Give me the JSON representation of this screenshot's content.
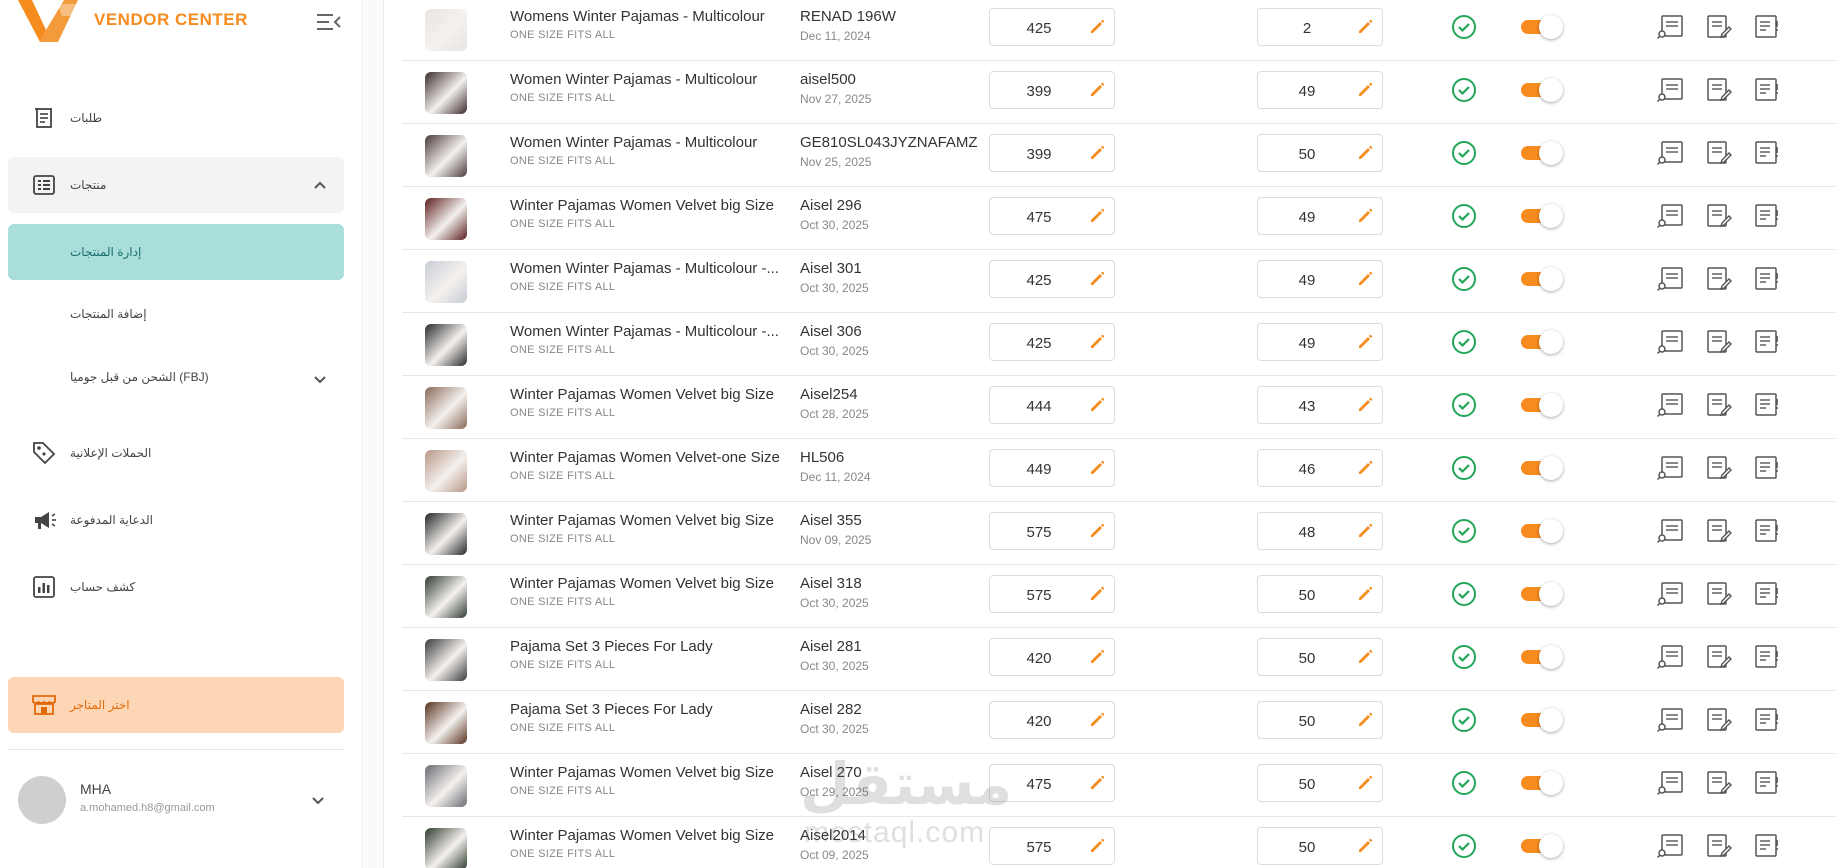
{
  "app": {
    "title": "VENDOR CENTER",
    "brand_color": "#f68b1e",
    "accent_color": "#a9dedb"
  },
  "sidebar": {
    "items": [
      {
        "label": "طلبات",
        "icon": "orders-icon"
      },
      {
        "label": "منتجات",
        "icon": "products-list-icon"
      },
      {
        "label": "إدارة المنتجات"
      },
      {
        "label": "إضافة المنتجات"
      },
      {
        "label": "الشحن من قبل جوميا (FBJ)"
      },
      {
        "label": "الحملات الإعلانية",
        "icon": "tag-icon"
      },
      {
        "label": "الدعاية المدفوعة",
        "icon": "megaphone-icon"
      },
      {
        "label": "كشف حساب",
        "icon": "bar-chart-icon"
      }
    ],
    "store_button": "اختر المتاجر",
    "profile": {
      "name": "MHA",
      "email": "a.mohamed.h8@gmail.com"
    }
  },
  "rows": [
    {
      "name": "Womens Winter Pajamas - Multicolour",
      "size": "ONE SIZE FITS ALL",
      "sku": "RENAD 196W",
      "date": "Dec 11, 2024",
      "price": "425",
      "stock": "2",
      "thumb": "#e8e4e0"
    },
    {
      "name": "Women Winter Pajamas - Multicolour",
      "size": "ONE SIZE FITS ALL",
      "sku": "aisel500",
      "date": "Nov 27, 2025",
      "price": "399",
      "stock": "49",
      "thumb": "#3a2b2b"
    },
    {
      "name": "Women Winter Pajamas - Multicolour",
      "size": "ONE SIZE FITS ALL",
      "sku": "GE810SL043JYZNAFAMZ",
      "date": "Nov 25, 2025",
      "price": "399",
      "stock": "50",
      "thumb": "#4a3a3a"
    },
    {
      "name": "Winter Pajamas Women Velvet big Size",
      "size": "ONE SIZE FITS ALL",
      "sku": "Aisel 296",
      "date": "Oct 30, 2025",
      "price": "475",
      "stock": "49",
      "thumb": "#5a1e1e"
    },
    {
      "name": "Women Winter Pajamas - Multicolour -...",
      "size": "ONE SIZE FITS ALL",
      "sku": "Aisel 301",
      "date": "Oct 30, 2025",
      "price": "425",
      "stock": "49",
      "thumb": "#c8ccd6"
    },
    {
      "name": "Women Winter Pajamas - Multicolour -...",
      "size": "ONE SIZE FITS ALL",
      "sku": "Aisel 306",
      "date": "Oct 30, 2025",
      "price": "425",
      "stock": "49",
      "thumb": "#2b2b2b"
    },
    {
      "name": "Winter Pajamas Women Velvet big Size",
      "size": "ONE SIZE FITS ALL",
      "sku": "Aisel254",
      "date": "Oct 28, 2025",
      "price": "444",
      "stock": "43",
      "thumb": "#8a6a58"
    },
    {
      "name": "Winter Pajamas Women Velvet-one Size",
      "size": "ONE SIZE FITS ALL",
      "sku": "HL506",
      "date": "Dec 11, 2024",
      "price": "449",
      "stock": "46",
      "thumb": "#b79686"
    },
    {
      "name": "Winter Pajamas Women Velvet big Size",
      "size": "ONE SIZE FITS ALL",
      "sku": "Aisel 355",
      "date": "Nov 09, 2025",
      "price": "575",
      "stock": "48",
      "thumb": "#262626"
    },
    {
      "name": "Winter Pajamas Women Velvet big Size",
      "size": "ONE SIZE FITS ALL",
      "sku": "Aisel 318",
      "date": "Oct 30, 2025",
      "price": "575",
      "stock": "50",
      "thumb": "#2f3a33"
    },
    {
      "name": "Pajama Set 3 Pieces For Lady",
      "size": "ONE SIZE FITS ALL",
      "sku": "Aisel 281",
      "date": "Oct 30, 2025",
      "price": "420",
      "stock": "50",
      "thumb": "#3a3a3a"
    },
    {
      "name": "Pajama Set 3 Pieces For Lady",
      "size": "ONE SIZE FITS ALL",
      "sku": "Aisel 282",
      "date": "Oct 30, 2025",
      "price": "420",
      "stock": "50",
      "thumb": "#5a3222"
    },
    {
      "name": "Winter Pajamas Women Velvet big Size",
      "size": "ONE SIZE FITS ALL",
      "sku": "Aisel 270",
      "date": "Oct 29, 2025",
      "price": "475",
      "stock": "50",
      "thumb": "#6a6a72"
    },
    {
      "name": "Winter Pajamas Women Velvet big Size",
      "size": "ONE SIZE FITS ALL",
      "sku": "Aisel2014",
      "date": "Oct 09, 2025",
      "price": "575",
      "stock": "50",
      "thumb": "#2e3a2e"
    }
  ],
  "watermark": {
    "arabic": "مستقل",
    "latin": "mostaql.com"
  }
}
